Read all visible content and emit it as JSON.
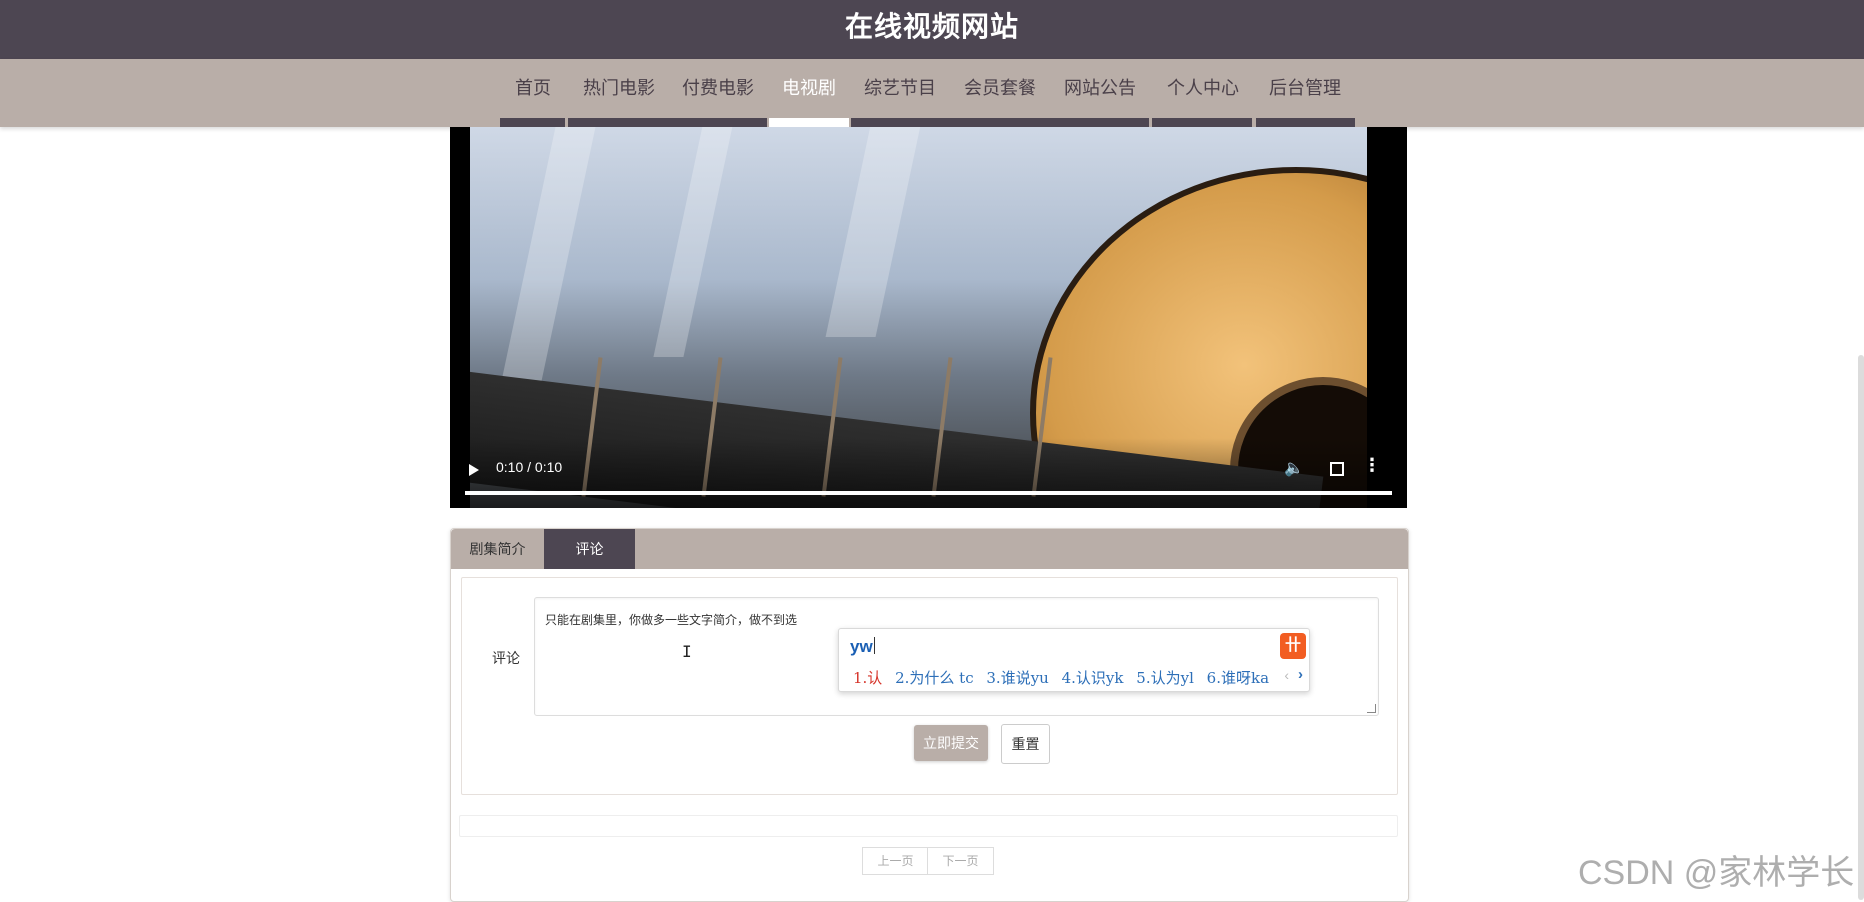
{
  "site": {
    "title": "在线视频网站"
  },
  "nav": {
    "items": [
      {
        "label": "首页"
      },
      {
        "label": "热门电影"
      },
      {
        "label": "付费电影"
      },
      {
        "label": "电视剧",
        "active": true
      },
      {
        "label": "综艺节目"
      },
      {
        "label": "会员套餐"
      },
      {
        "label": "网站公告"
      },
      {
        "label": "个人中心"
      },
      {
        "label": "后台管理"
      }
    ]
  },
  "video": {
    "time": "0:10 / 0:10",
    "progress": 1.0
  },
  "detail_tabs": [
    {
      "label": "剧集简介"
    },
    {
      "label": "评论",
      "active": true
    }
  ],
  "comment_form": {
    "label": "评论",
    "text": "只能在剧集里，你做多一些文字简介，做不到选",
    "submit_label": "立即提交",
    "reset_label": "重置"
  },
  "ime": {
    "input": "yw",
    "candidates": [
      "1.认",
      "2.为什么 tc",
      "3.谁说yu",
      "4.认识yk",
      "5.认为yl",
      "6.谁呀ka"
    ],
    "logo": "搜狗"
  },
  "pagination": {
    "prev_label": "上一页",
    "next_label": "下一页"
  },
  "watermark": "CSDN @家林学长",
  "colors": {
    "header": "#4d4652",
    "nav": "#b9aea8",
    "accent": "#ffffff"
  }
}
